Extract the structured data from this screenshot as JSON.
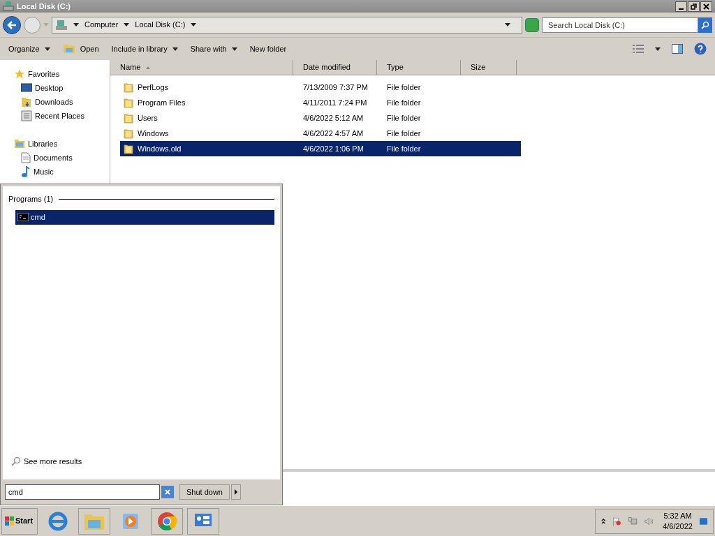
{
  "window": {
    "title": "Local Disk (C:)"
  },
  "address": {
    "crumbs": [
      "Computer",
      "Local Disk (C:)"
    ]
  },
  "search": {
    "placeholder": "Search Local Disk (C:)"
  },
  "toolbar": [
    {
      "label": "Organize",
      "dropdown": true,
      "kind": "plain"
    },
    {
      "label": "Open",
      "dropdown": false,
      "kind": "open"
    },
    {
      "label": "Include in library",
      "dropdown": true,
      "kind": "plain"
    },
    {
      "label": "Share with",
      "dropdown": true,
      "kind": "plain"
    },
    {
      "label": "New folder",
      "dropdown": false,
      "kind": "plain"
    }
  ],
  "sidebar": [
    {
      "label": "Favorites",
      "kind": "favorites",
      "items": [
        "Desktop",
        "Downloads",
        "Recent Places"
      ]
    },
    {
      "label": "Libraries",
      "kind": "libraries",
      "items": [
        "Documents",
        "Music"
      ]
    }
  ],
  "table": {
    "columns": [
      {
        "label": "Name",
        "sorted": true
      },
      {
        "label": "Date modified",
        "sorted": false
      },
      {
        "label": "Type",
        "sorted": false
      },
      {
        "label": "Size",
        "sorted": false
      }
    ],
    "rows": [
      {
        "name": "PerfLogs",
        "date": "7/13/2009 7:37 PM",
        "type": "File folder",
        "selected": false
      },
      {
        "name": "Program Files",
        "date": "4/11/2011 7:24 PM",
        "type": "File folder",
        "selected": false
      },
      {
        "name": "Users",
        "date": "4/6/2022 5:12 AM",
        "type": "File folder",
        "selected": false
      },
      {
        "name": "Windows",
        "date": "4/6/2022 4:57 AM",
        "type": "File folder",
        "selected": false
      },
      {
        "name": "Windows.old",
        "date": "4/6/2022 1:06 PM",
        "type": "File folder",
        "selected": true
      }
    ]
  },
  "start_menu": {
    "section": "Programs (1)",
    "results": [
      {
        "label": "cmd",
        "selected": true
      }
    ],
    "see_more": "See more results",
    "search_value": "cmd",
    "shutdown": "Shut down"
  },
  "taskbar": {
    "start": "Start",
    "time": "5:32 AM",
    "date": "4/6/2022"
  }
}
